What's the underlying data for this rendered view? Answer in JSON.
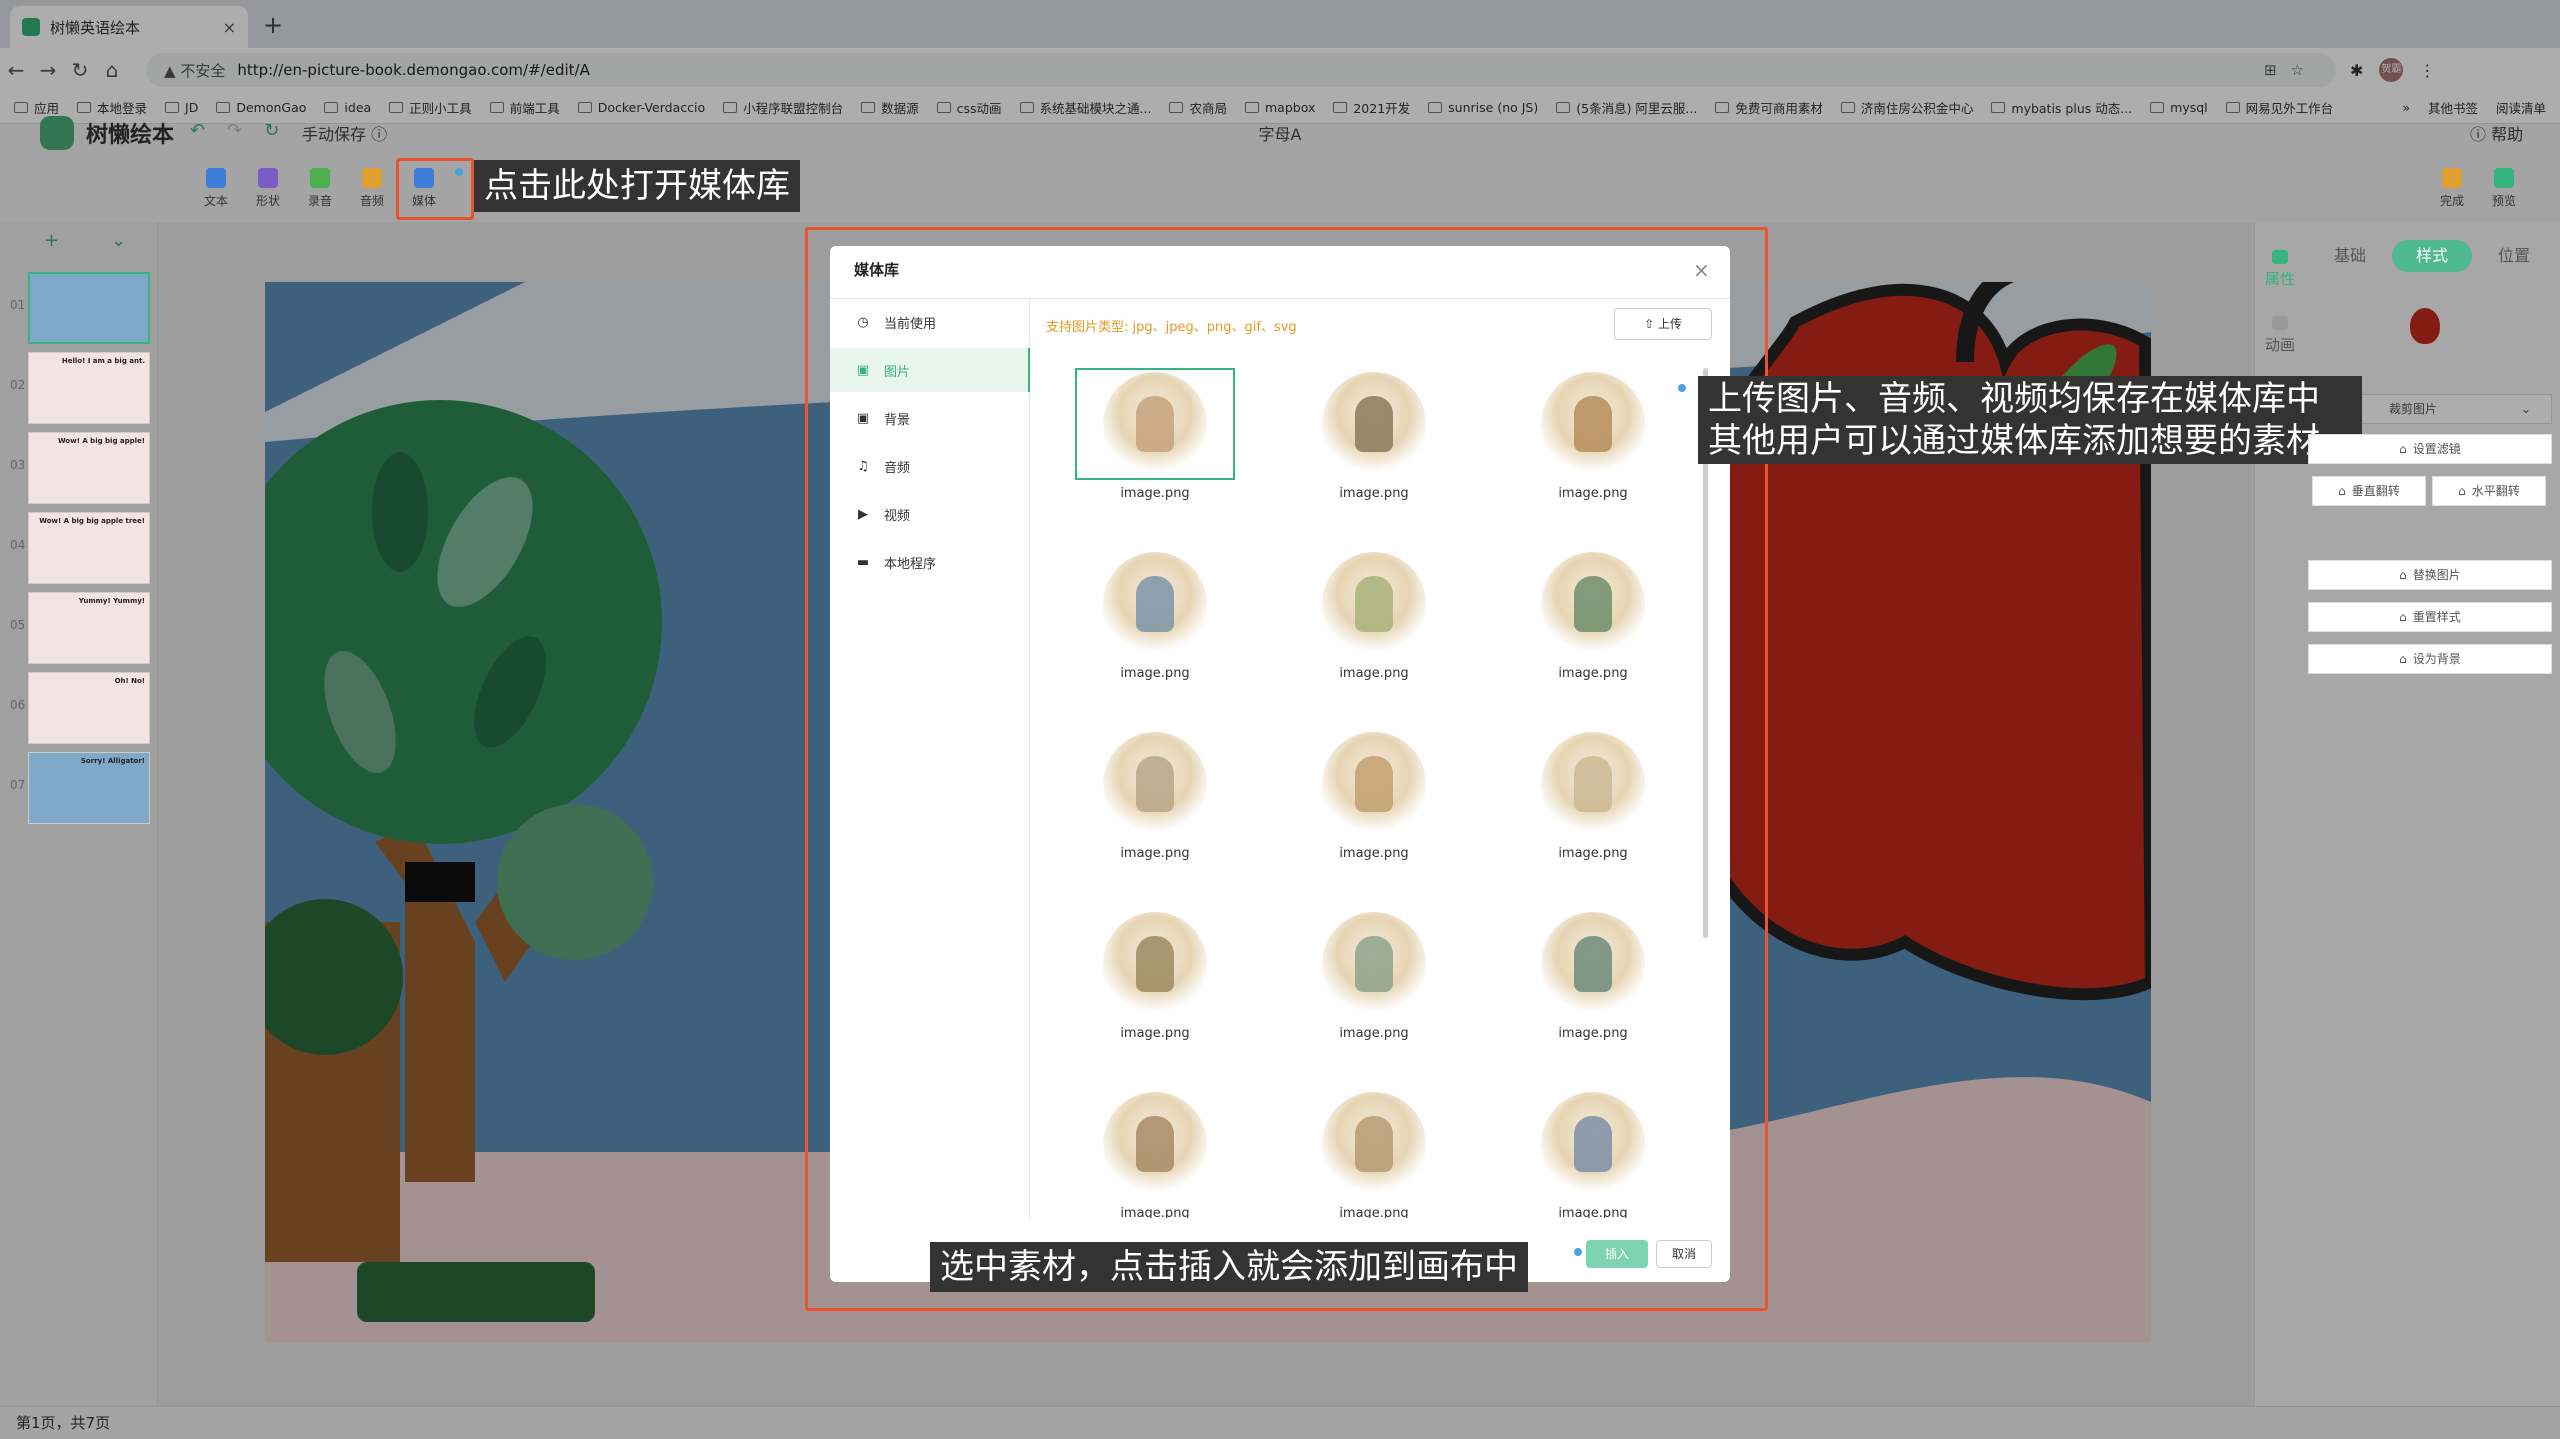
{
  "browser": {
    "tab_title": "树懒英语绘本",
    "tab_close": "×",
    "new_tab": "+",
    "security_label": "不安全",
    "url": "http://en-picture-book.demongao.com/#/edit/A",
    "bookmarks": [
      "应用",
      "本地登录",
      "JD",
      "DemonGao",
      "idea",
      "正则小工具",
      "前端工具",
      "Docker-Verdaccio",
      "小程序联盟控制台",
      "数据源",
      "css动画",
      "系统基础模块之通...",
      "农商局",
      "mapbox",
      "2021开发",
      "sunrise (no JS)",
      "(5条消息) 阿里云服...",
      "免费可商用素材",
      "济南住房公积金中心",
      "mybatis plus 动态...",
      "mysql",
      "网易见外工作台"
    ],
    "bookmarks_more": "»",
    "other_bookmarks": "其他书签",
    "reading_list": "阅读清单",
    "avatar_text": "贺霸"
  },
  "app": {
    "logo_text": "树懒绘本",
    "save_mode": "手动保存 ⓘ",
    "doc_title": "字母A",
    "help": "ⓘ 帮助",
    "toolbar": [
      {
        "label": "文本",
        "color": "#3b7dd8"
      },
      {
        "label": "形状",
        "color": "#7a5cc9"
      },
      {
        "label": "录音",
        "color": "#4caf50"
      },
      {
        "label": "音频",
        "color": "#e0a030"
      },
      {
        "label": "媒体",
        "color": "#3b7dd8"
      }
    ],
    "right_tools": [
      {
        "label": "完成",
        "color": "#e0a030"
      },
      {
        "label": "预览",
        "color": "#36b37e"
      }
    ],
    "add_page": "+",
    "collapse": "⌄",
    "pages": [
      {
        "num": "01",
        "caption": ""
      },
      {
        "num": "02",
        "caption": "Hello! I am a big ant."
      },
      {
        "num": "03",
        "caption": "Wow! A big big apple!"
      },
      {
        "num": "04",
        "caption": "Wow! A big big apple tree!"
      },
      {
        "num": "05",
        "caption": "Yummy! Yummy!"
      },
      {
        "num": "06",
        "caption": "Oh! No!"
      },
      {
        "num": "07",
        "caption": "Sorry! Alligator!"
      }
    ],
    "status": "第1页，共7页"
  },
  "right_panel": {
    "side_tabs": [
      "属性",
      "动画"
    ],
    "tabs": [
      "基础",
      "样式",
      "位置"
    ],
    "active_tab": "样式",
    "crop": "裁剪图片",
    "buttons": [
      "设置滤镜",
      "垂直翻转",
      "水平翻转",
      "替换图片",
      "重置样式",
      "设为背景"
    ]
  },
  "modal": {
    "title": "媒体库",
    "close": "×",
    "nav": [
      {
        "icon": "◷",
        "label": "当前使用"
      },
      {
        "icon": "▣",
        "label": "图片"
      },
      {
        "icon": "▣",
        "label": "背景"
      },
      {
        "icon": "♫",
        "label": "音频"
      },
      {
        "icon": "▶",
        "label": "视频"
      },
      {
        "icon": "▬",
        "label": "本地程序"
      }
    ],
    "active_nav": "图片",
    "supported_types": "支持图片类型: jpg、jpeg、png、gif、svg",
    "upload": "⇧ 上传",
    "images": [
      "image.png",
      "image.png",
      "image.png",
      "image.png",
      "image.png",
      "image.png",
      "image.png",
      "image.png",
      "image.png",
      "image.png",
      "image.png",
      "image.png",
      "image.png",
      "image.png",
      "image.png"
    ],
    "selected_index": 0,
    "insert": "插入",
    "cancel": "取消"
  },
  "annotations": {
    "open_media": "点击此处打开媒体库",
    "upload_note_line1": "上传图片、音频、视频均保存在媒体库中",
    "upload_note_line2": "其他用户可以通过媒体库添加想要的素材",
    "insert_note": "选中素材，点击插入就会添加到画布中"
  },
  "colors": {
    "accent": "#36b37e",
    "highlight_frame": "#e8542d",
    "warning_text": "#e59923"
  }
}
